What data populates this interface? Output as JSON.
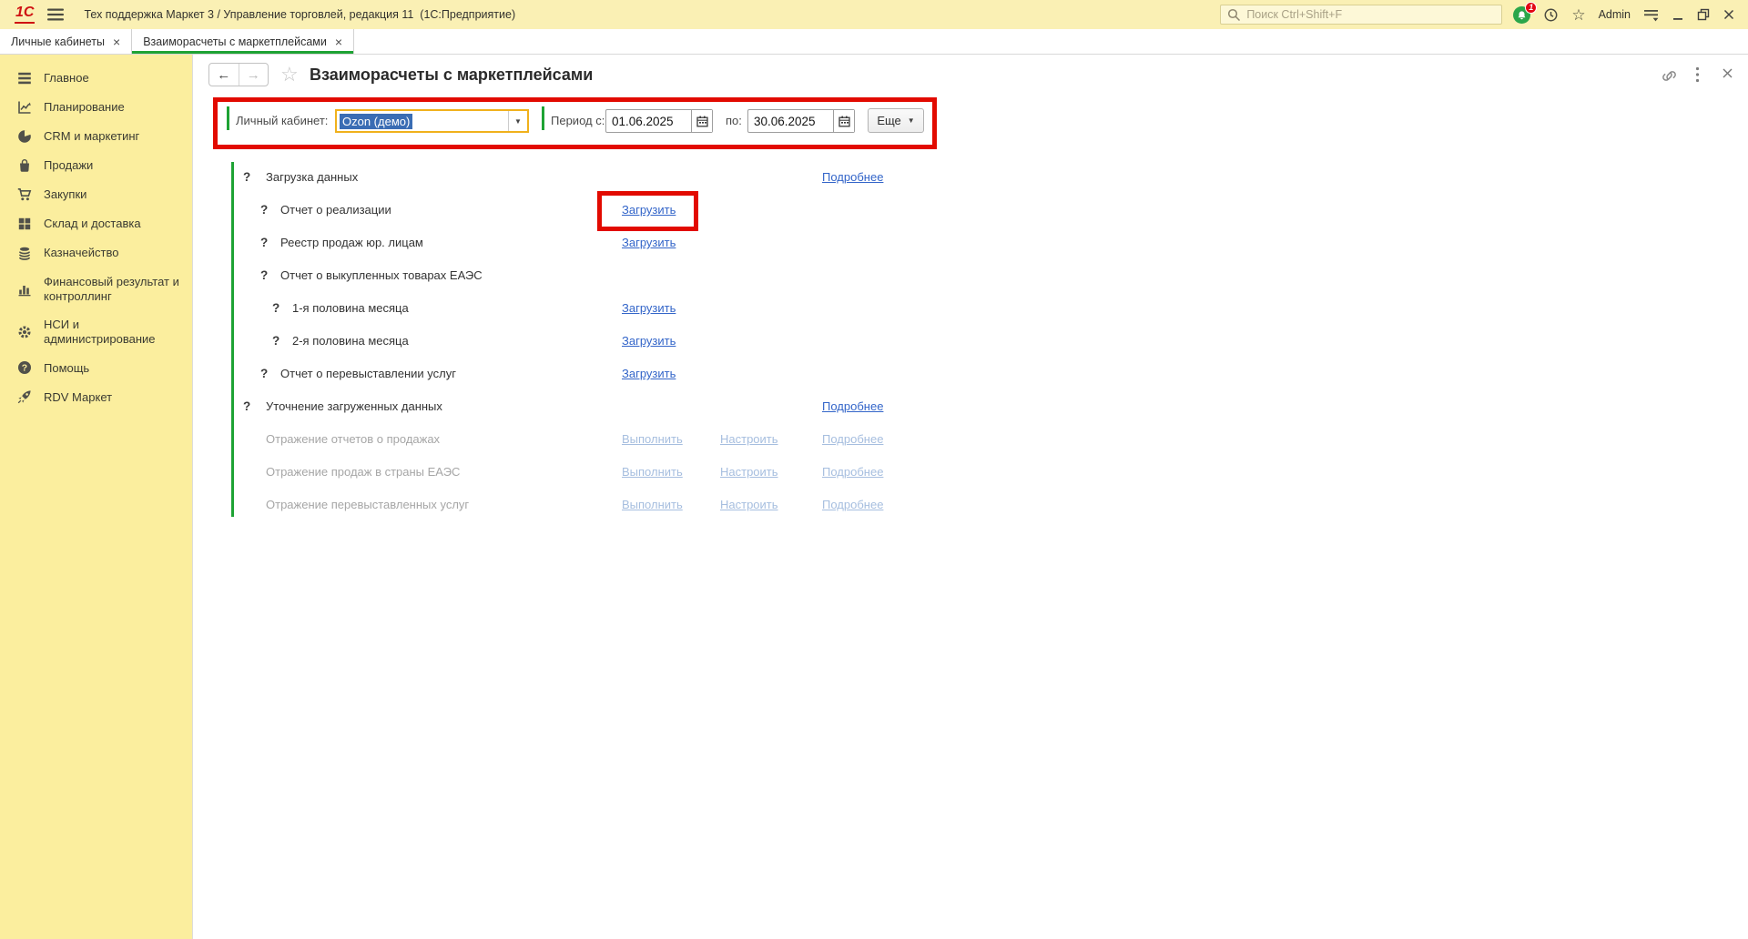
{
  "titlebar": {
    "logo": "1С",
    "title": "Тех поддержка Маркет 3 / Управление торговлей, редакция 11  (1С:Предприятие)",
    "search_placeholder": "Поиск Ctrl+Shift+F",
    "notification_badge": "1",
    "user": "Admin"
  },
  "tabs": [
    {
      "name": "tab-personal-cabinets",
      "label": "Личные кабинеты",
      "active": false
    },
    {
      "name": "tab-marketplace-settlements",
      "label": "Взаиморасчеты с маркетплейсами",
      "active": true
    }
  ],
  "sidebar": {
    "items": [
      {
        "key": "home",
        "icon": "menu-icon",
        "label": "Главное"
      },
      {
        "key": "planning",
        "icon": "planning-icon",
        "label": "Планирование"
      },
      {
        "key": "crm-marketing",
        "icon": "pie-chart-icon",
        "label": "CRM и маркетинг"
      },
      {
        "key": "sales",
        "icon": "bag-icon",
        "label": "Продажи"
      },
      {
        "key": "purchases",
        "icon": "cart-icon",
        "label": "Закупки"
      },
      {
        "key": "warehouse-delivery",
        "icon": "boxes-icon",
        "label": "Склад и доставка"
      },
      {
        "key": "treasury",
        "icon": "coins-icon",
        "label": "Казначейство"
      },
      {
        "key": "financial-result",
        "icon": "bar-chart-icon",
        "label": "Финансовый результат и контроллинг"
      },
      {
        "key": "nsi-administration",
        "icon": "gear-icon",
        "label": "НСИ и администрирование"
      },
      {
        "key": "help",
        "icon": "help-circle-icon",
        "label": "Помощь"
      },
      {
        "key": "rdv-market",
        "icon": "rocket-icon",
        "label": "RDV Маркет"
      }
    ]
  },
  "page": {
    "title": "Взаиморасчеты с маркетплейсами",
    "filter": {
      "cabinet_label": "Личный кабинет:",
      "cabinet_value": "Ozon (демо)",
      "period_from_label": "Период с:",
      "period_from": "01.06.2025",
      "period_to_label": "по:",
      "period_to": "30.06.2025",
      "more_button": "Еще"
    },
    "rows": [
      {
        "question": true,
        "indent": 0,
        "muted": false,
        "label": "Загрузка данных",
        "links": [
          {
            "label": "Подробнее",
            "name": "details-link",
            "slot": 3
          }
        ]
      },
      {
        "question": true,
        "indent": 1,
        "muted": false,
        "label": "Отчет о реализации",
        "links": [
          {
            "label": "Загрузить",
            "name": "download-link",
            "slot": 1
          }
        ]
      },
      {
        "question": true,
        "indent": 1,
        "muted": false,
        "label": "Реестр продаж юр. лицам",
        "links": [
          {
            "label": "Загрузить",
            "name": "download-link",
            "slot": 1
          }
        ]
      },
      {
        "question": true,
        "indent": 1,
        "muted": false,
        "label": "Отчет о выкупленных товарах ЕАЭС",
        "links": []
      },
      {
        "question": true,
        "indent": 2,
        "muted": false,
        "label": "1-я половина месяца",
        "links": [
          {
            "label": "Загрузить",
            "name": "download-link",
            "slot": 1
          }
        ]
      },
      {
        "question": true,
        "indent": 2,
        "muted": false,
        "label": "2-я половина месяца",
        "links": [
          {
            "label": "Загрузить",
            "name": "download-link",
            "slot": 1
          }
        ]
      },
      {
        "question": true,
        "indent": 1,
        "muted": false,
        "label": "Отчет о перевыставлении услуг",
        "links": [
          {
            "label": "Загрузить",
            "name": "download-link",
            "slot": 1
          }
        ]
      },
      {
        "question": true,
        "indent": 0,
        "muted": false,
        "label": "Уточнение загруженных данных",
        "links": [
          {
            "label": "Подробнее",
            "name": "details-link",
            "slot": 3
          }
        ]
      },
      {
        "question": false,
        "indent": 0,
        "muted": true,
        "label": "Отражение отчетов о продажах",
        "links": [
          {
            "label": "Выполнить",
            "name": "run-link",
            "slot": 1
          },
          {
            "label": "Настроить",
            "name": "configure-link",
            "slot": 2
          },
          {
            "label": "Подробнее",
            "name": "details-link",
            "slot": 3
          }
        ]
      },
      {
        "question": false,
        "indent": 0,
        "muted": true,
        "label": "Отражение продаж в страны ЕАЭС",
        "links": [
          {
            "label": "Выполнить",
            "name": "run-link",
            "slot": 1
          },
          {
            "label": "Настроить",
            "name": "configure-link",
            "slot": 2
          },
          {
            "label": "Подробнее",
            "name": "details-link",
            "slot": 3
          }
        ]
      },
      {
        "question": false,
        "indent": 0,
        "muted": true,
        "label": "Отражение перевыставленных услуг",
        "links": [
          {
            "label": "Выполнить",
            "name": "run-link",
            "slot": 1
          },
          {
            "label": "Настроить",
            "name": "configure-link",
            "slot": 2
          },
          {
            "label": "Подробнее",
            "name": "details-link",
            "slot": 3
          }
        ]
      }
    ]
  },
  "colors": {
    "accent_green": "#1ea334",
    "annotation_red": "#e20a00",
    "link_blue": "#3365c9",
    "muted_link_blue": "#a6bedf",
    "selection_blue": "#3a6db4",
    "focus_border_gold": "#f0b11c",
    "titlebar_yellow": "#faf0b4",
    "sidebar_yellow": "#fbee9e"
  }
}
